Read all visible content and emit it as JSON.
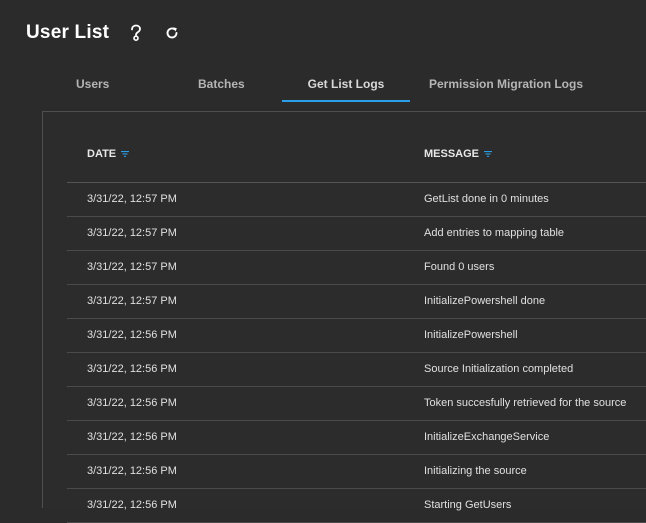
{
  "header": {
    "title": "User List",
    "help_icon": "help-question-icon",
    "refresh_icon": "refresh-icon"
  },
  "tabs": [
    {
      "label": "Users",
      "active": false
    },
    {
      "label": "Batches",
      "active": false
    },
    {
      "label": "Get List Logs",
      "active": true
    },
    {
      "label": "Permission Migration Logs",
      "active": false
    }
  ],
  "table": {
    "columns": {
      "date": "DATE",
      "message": "MESSAGE"
    },
    "rows": [
      {
        "date": "3/31/22, 12:57 PM",
        "message": "GetList done in 0 minutes"
      },
      {
        "date": "3/31/22, 12:57 PM",
        "message": "Add entries to mapping table"
      },
      {
        "date": "3/31/22, 12:57 PM",
        "message": "Found 0 users"
      },
      {
        "date": "3/31/22, 12:57 PM",
        "message": "InitializePowershell done"
      },
      {
        "date": "3/31/22, 12:56 PM",
        "message": "InitializePowershell"
      },
      {
        "date": "3/31/22, 12:56 PM",
        "message": "Source Initialization completed"
      },
      {
        "date": "3/31/22, 12:56 PM",
        "message": "Token succesfully retrieved for the source"
      },
      {
        "date": "3/31/22, 12:56 PM",
        "message": "InitializeExchangeService"
      },
      {
        "date": "3/31/22, 12:56 PM",
        "message": "Initializing the source"
      },
      {
        "date": "3/31/22, 12:56 PM",
        "message": "Starting GetUsers"
      }
    ]
  },
  "colors": {
    "background": "#2b2b2b",
    "accent": "#2b9ee8",
    "text": "#e0e0e0"
  }
}
